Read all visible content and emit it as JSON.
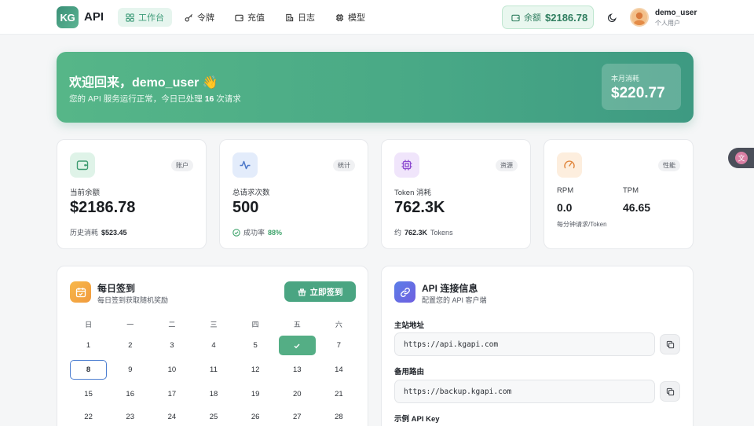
{
  "header": {
    "logo_badge": "KG",
    "logo_text": "API",
    "nav": [
      {
        "label": "工作台",
        "icon": "grid-icon",
        "active": true
      },
      {
        "label": "令牌",
        "icon": "key-icon",
        "active": false
      },
      {
        "label": "充值",
        "icon": "wallet-icon",
        "active": false
      },
      {
        "label": "日志",
        "icon": "log-icon",
        "active": false
      },
      {
        "label": "模型",
        "icon": "chip-icon",
        "active": false
      }
    ],
    "balance_label": "余额",
    "balance_value": "$2186.78",
    "user_name": "demo_user",
    "user_role": "个人用户"
  },
  "banner": {
    "title": "欢迎回来，demo_user 👋",
    "sub_prefix": "您的 API 服务运行正常，今日已处理",
    "sub_count": "16",
    "sub_suffix": "次请求",
    "month_label": "本月消耗",
    "month_value": "$220.77"
  },
  "stats": [
    {
      "tag": "账户",
      "label": "当前余额",
      "value": "$2186.78",
      "foot_label": "历史消耗",
      "foot_value": "$523.45"
    },
    {
      "tag": "统计",
      "label": "总请求次数",
      "value": "500",
      "foot_label": "成功率",
      "foot_value": "88%"
    },
    {
      "tag": "资源",
      "label": "Token 消耗",
      "value": "762.3K",
      "foot_prefix": "约",
      "foot_value": "762.3K",
      "foot_suffix": "Tokens"
    },
    {
      "tag": "性能",
      "rpm_label": "RPM",
      "rpm_value": "0.0",
      "tpm_label": "TPM",
      "tpm_value": "46.65",
      "note": "每分钟请求/Token"
    }
  ],
  "checkin": {
    "title": "每日签到",
    "subtitle": "每日签到获取随机奖励",
    "button_label": "立即签到",
    "weekdays": [
      "日",
      "一",
      "二",
      "三",
      "四",
      "五",
      "六"
    ],
    "weeks": [
      [
        "1",
        "2",
        "3",
        "4",
        "5",
        "",
        "7"
      ],
      [
        "8",
        "9",
        "10",
        "11",
        "12",
        "13",
        "14"
      ],
      [
        "15",
        "16",
        "17",
        "18",
        "19",
        "20",
        "21"
      ],
      [
        "22",
        "23",
        "24",
        "25",
        "26",
        "27",
        "28"
      ]
    ],
    "checked_day": "6",
    "today": "8"
  },
  "api": {
    "title": "API 连接信息",
    "subtitle": "配置您的 API 客户端",
    "main_label": "主站地址",
    "main_url": "https://api.kgapi.com",
    "backup_label": "备用路由",
    "backup_url": "https://backup.kgapi.com",
    "key_label": "示例 API Key"
  },
  "colors": {
    "brand": "#4aa582",
    "accent_blue": "#4d7fd1"
  }
}
